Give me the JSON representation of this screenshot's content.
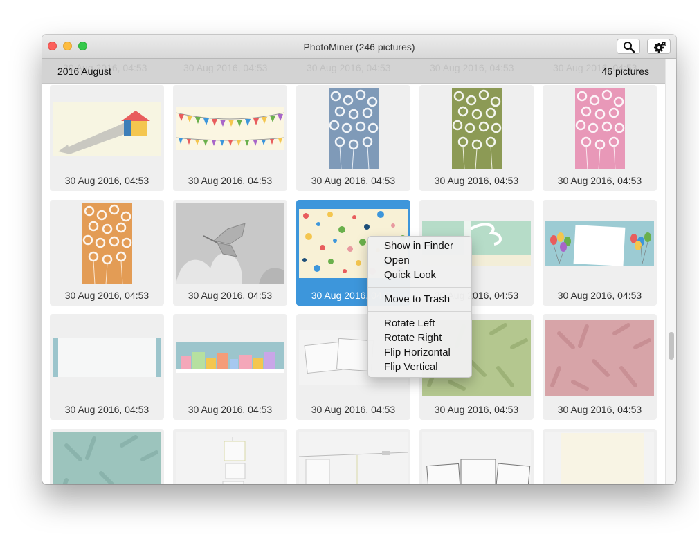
{
  "window": {
    "title": "PhotoMiner (246 pictures)"
  },
  "toolbar": {
    "search_icon": "magnifier-icon",
    "settings_icon": "gear-icon"
  },
  "section": {
    "title": "2016 August",
    "count": "46 pictures",
    "ghost_caption": "30 Aug 2016, 04:53"
  },
  "photos": [
    {
      "caption": "30 Aug 2016, 04:53",
      "kind": "house-arrow"
    },
    {
      "caption": "30 Aug 2016, 04:53",
      "kind": "bunting"
    },
    {
      "caption": "30 Aug 2016, 04:53",
      "kind": "flowers-blue"
    },
    {
      "caption": "30 Aug 2016, 04:53",
      "kind": "flowers-green"
    },
    {
      "caption": "30 Aug 2016, 04:53",
      "kind": "flowers-pink"
    },
    {
      "caption": "30 Aug 2016, 04:53",
      "kind": "flowers-orange"
    },
    {
      "caption": "30 Aug 2016, 04:53",
      "kind": "butterfly"
    },
    {
      "caption": "30 Aug 2016, 04:53",
      "kind": "polka-dots",
      "selected": true
    },
    {
      "caption": "30 Aug 2016, 04:53",
      "kind": "mint-ribbon"
    },
    {
      "caption": "30 Aug 2016, 04:53",
      "kind": "balloons"
    },
    {
      "caption": "30 Aug 2016, 04:53",
      "kind": "blank-banner"
    },
    {
      "caption": "30 Aug 2016, 04:53",
      "kind": "gift-boxes"
    },
    {
      "caption": "30 Aug 2016, 04:53",
      "kind": "photo-frames"
    },
    {
      "caption": "30 Aug 2016, 04:53",
      "kind": "leaves-green"
    },
    {
      "caption": "30 Aug 2016, 04:53",
      "kind": "leaves-pink"
    },
    {
      "caption": "",
      "kind": "leaves-teal"
    },
    {
      "caption": "",
      "kind": "hanging-frames"
    },
    {
      "caption": "",
      "kind": "clothesline"
    },
    {
      "caption": "",
      "kind": "polaroids"
    },
    {
      "caption": "",
      "kind": "cream-paper"
    }
  ],
  "context_menu": {
    "show_in_finder": "Show in Finder",
    "open": "Open",
    "quick_look": "Quick Look",
    "move_to_trash": "Move to Trash",
    "rotate_left": "Rotate Left",
    "rotate_right": "Rotate Right",
    "flip_horizontal": "Flip Horizontal",
    "flip_vertical": "Flip Vertical"
  }
}
